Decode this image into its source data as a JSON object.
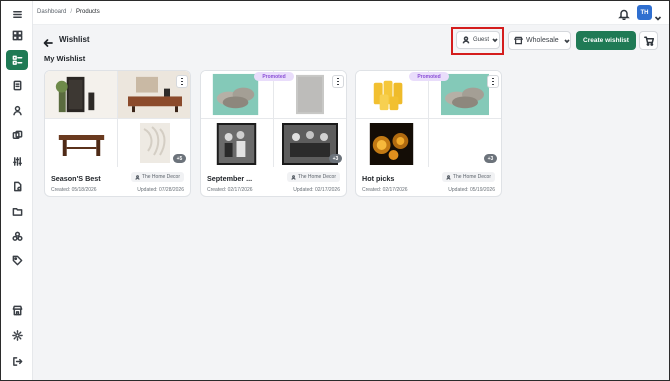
{
  "breadcrumb": {
    "parent": "Dashboard",
    "separator": "/",
    "current": "Products"
  },
  "user": {
    "initials": "TH",
    "avatar_color": "#2f6fd0"
  },
  "page": {
    "title": "Wishlist",
    "section": "My Wishlist"
  },
  "toolbar": {
    "guest_label": "Guest",
    "wholesale_label": "Wholesale",
    "create_label": "Create wishlist"
  },
  "colors": {
    "accent": "#1f7a55",
    "highlight": "#d41d1d",
    "promoted_bg": "#e9ddfb",
    "promoted_text": "#8a4fd6"
  },
  "sidebar": {
    "items": [
      {
        "name": "dashboard-icon",
        "active": false
      },
      {
        "name": "products-icon",
        "active": true
      },
      {
        "name": "orders-icon",
        "active": false
      },
      {
        "name": "user-icon",
        "active": false
      },
      {
        "name": "stack-icon",
        "active": false
      },
      {
        "name": "sliders-icon",
        "active": false
      },
      {
        "name": "document-icon",
        "active": false
      },
      {
        "name": "folder-icon",
        "active": false
      },
      {
        "name": "circles-icon",
        "active": false
      },
      {
        "name": "tag-icon",
        "active": false
      },
      {
        "name": "store-icon",
        "active": false
      },
      {
        "name": "gear-icon",
        "active": false
      },
      {
        "name": "logout-icon",
        "active": false
      }
    ]
  },
  "wishlists": [
    {
      "title": "Season'S Best",
      "shop": "The Home Decor",
      "created": "Created: 05/18/2026",
      "updated": "Updated: 07/28/2026",
      "promoted": "",
      "extra": "+5"
    },
    {
      "title": "September ...",
      "shop": "The Home Decor",
      "created": "Created: 02/17/2026",
      "updated": "Updated: 02/17/2026",
      "promoted": "Promoted",
      "extra": "+3"
    },
    {
      "title": "Hot picks",
      "shop": "The Home Decor",
      "created": "Created: 02/17/2026",
      "updated": "Updated: 05/19/2026",
      "promoted": "Promoted",
      "extra": "+3"
    }
  ]
}
